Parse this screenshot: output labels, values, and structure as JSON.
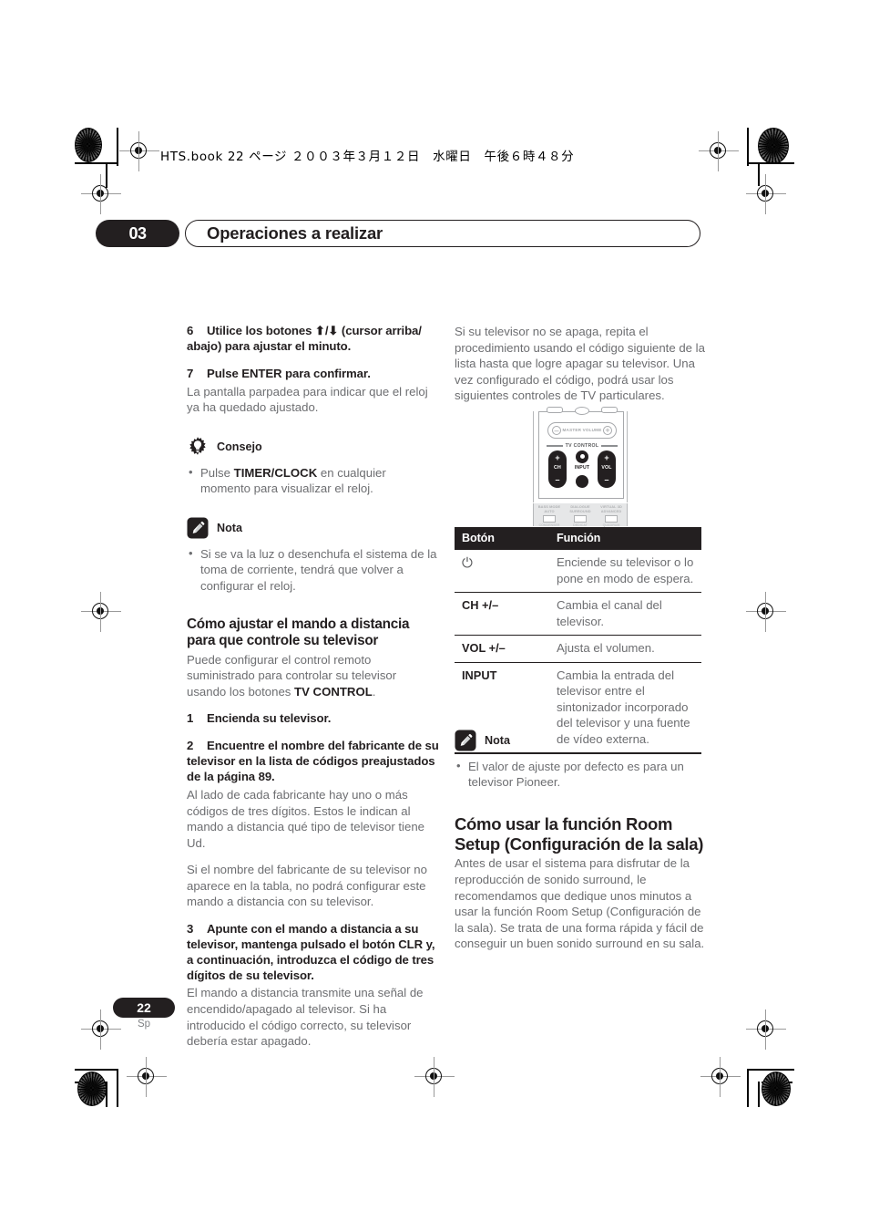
{
  "page": {
    "running_header": "HTS.book 22 ページ ２００３年３月１２日　水曜日　午後６時４８分",
    "chapter_number": "03",
    "chapter_title": "Operaciones a realizar",
    "page_number": "22",
    "language_code": "Sp"
  },
  "left_column": {
    "step6_num": "6",
    "step6_text": "Utilice los botones ⬆/⬇ (cursor arriba/ abajo) para ajustar el minuto.",
    "step7_num": "7",
    "step7_text": "Pulse ENTER para confirmar.",
    "step7_body": "La pantalla parpadea para indicar que el reloj ya ha quedado ajustado.",
    "tip_label": "Consejo",
    "tip_bullet_pre": "Pulse ",
    "tip_bullet_bold": "TIMER/CLOCK",
    "tip_bullet_post": " en cualquier momento para visualizar el reloj.",
    "note_label": "Nota",
    "note_bullet": "Si se va la luz o desenchufa el sistema de la toma de corriente, tendrá que volver a configurar el reloj.",
    "heading_tv": "Cómo ajustar el mando a distancia para que controle su televisor",
    "tv_intro_pre": "Puede configurar el control remoto suministrado para controlar su televisor usando los botones ",
    "tv_intro_bold": "TV CONTROL",
    "tv_intro_post": ".",
    "step1_num": "1",
    "step1_text": "Encienda su televisor.",
    "step2_num": "2",
    "step2_text": "Encuentre el nombre del fabricante de su televisor en la lista de códigos preajustados de la página 89.",
    "step2_body": "Al lado de cada fabricante hay uno o más códigos de tres dígitos. Estos le indican al mando a distancia qué tipo de televisor tiene Ud.",
    "step2_body2": "Si el nombre del fabricante de su televisor no aparece en la tabla, no podrá configurar este mando a distancia con su televisor.",
    "step3_num": "3",
    "step3_text": "Apunte con el mando a distancia a su televisor, mantenga pulsado el botón CLR y, a continuación, introduzca el código de tres dígitos de su televisor.",
    "step3_body": "El mando a distancia transmite una señal de encendido/apagado al televisor. Si ha introducido el código correcto, su televisor debería estar apagado."
  },
  "right_column": {
    "intro": "Si su televisor no se apaga, repita el procedimiento usando el código siguiente de la lista hasta que logre apagar su televisor. Una vez configurado el código, podrá usar los siguientes controles de TV particulares.",
    "note_label": "Nota",
    "note_bullet": "El valor de ajuste por defecto es para un televisor Pioneer.",
    "heading_room": "Cómo usar la función Room Setup (Configuración de la sala)",
    "room_body": "Antes de usar el sistema para disfrutar de la reproducción de sonido surround, le recomendamos que dedique unos minutos a usar la función Room Setup (Configuración de la sala). Se trata de una forma rápida y fácil de conseguir un buen sonido surround en su sala."
  },
  "remote": {
    "master_volume_label": "MASTER VOLUME",
    "minus": "–",
    "plus": "+",
    "tv_control_label": "TV CONTROL",
    "ch_label": "CH",
    "input_label": "INPUT",
    "vol_label": "VOL",
    "foot_keys": [
      {
        "top": "BASS MODE AUTO",
        "bottom": "CONDENSER"
      },
      {
        "top": "DIALOGUE SURROUND",
        "bottom": "DEDICAT"
      },
      {
        "top": "VIRTUAL 3D ADVANCED",
        "bottom": "QUADRUM"
      }
    ]
  },
  "table": {
    "headers": [
      "Botón",
      "Función"
    ],
    "rows": [
      {
        "button": "⏻",
        "button_is_glyph": true,
        "function": "Enciende su televisor o lo pone en modo de espera."
      },
      {
        "button": "CH +/–",
        "function": "Cambia el canal del televisor."
      },
      {
        "button": "VOL +/–",
        "function": "Ajusta el volumen."
      },
      {
        "button": "INPUT",
        "function": "Cambia la entrada del televisor entre el sintonizador incorporado del televisor y una fuente de vídeo externa."
      }
    ]
  },
  "colors": {
    "ink_black": "#231f20",
    "body_gray": "#6d6e71",
    "rule_gray": "#a7a9ac"
  }
}
